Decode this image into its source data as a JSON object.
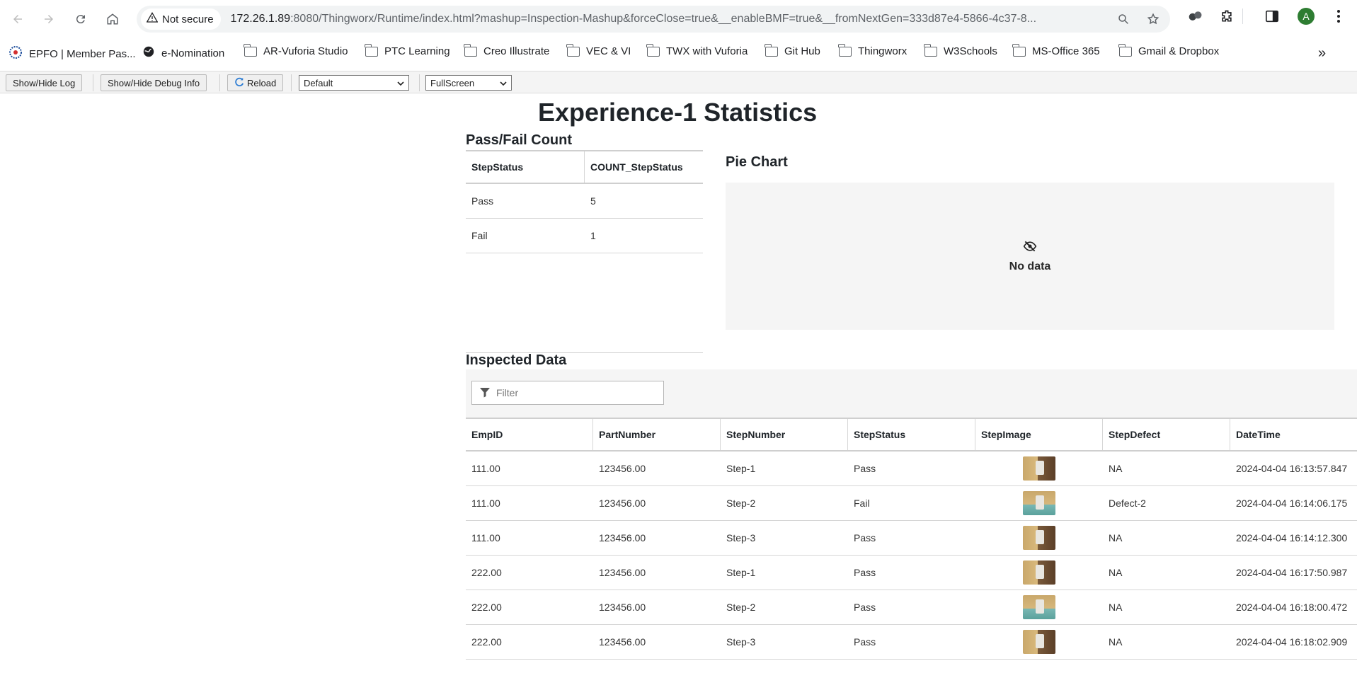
{
  "browser": {
    "security_label": "Not secure",
    "url_host": "172.26.1.89",
    "url_rest": ":8080/Thingworx/Runtime/index.html?mashup=Inspection-Mashup&forceClose=true&__enableBMF=true&__fromNextGen=333d87e4-5866-4c37-8...",
    "avatar_letter": "A"
  },
  "bookmarks": [
    {
      "label": "EPFO | Member Pas...",
      "icon": "epfo-logo-icon"
    },
    {
      "label": "e-Nomination",
      "icon": "globe-icon"
    },
    {
      "label": "AR-Vuforia Studio",
      "icon": "folder-icon"
    },
    {
      "label": "PTC Learning",
      "icon": "folder-icon"
    },
    {
      "label": "Creo Illustrate",
      "icon": "folder-icon"
    },
    {
      "label": "VEC & VI",
      "icon": "folder-icon"
    },
    {
      "label": "TWX with Vuforia",
      "icon": "folder-icon"
    },
    {
      "label": "Git Hub",
      "icon": "folder-icon"
    },
    {
      "label": "Thingworx",
      "icon": "folder-icon"
    },
    {
      "label": "W3Schools",
      "icon": "folder-icon"
    },
    {
      "label": "MS-Office 365",
      "icon": "folder-icon"
    },
    {
      "label": "Gmail & Dropbox",
      "icon": "folder-icon"
    }
  ],
  "toolbar": {
    "log_label": "Show/Hide Log",
    "debug_label": "Show/Hide Debug Info",
    "reload_label": "Reload",
    "theme_select": "Default",
    "view_select": "FullScreen"
  },
  "page": {
    "title": "Experience-1 Statistics",
    "count_title": "Pass/Fail Count",
    "pie_title": "Pie Chart",
    "pie_empty": "No data",
    "inspected_title": "Inspected Data",
    "filter_placeholder": "Filter"
  },
  "count_table": {
    "headers": [
      "StepStatus",
      "COUNT_StepStatus"
    ],
    "rows": [
      [
        "Pass",
        "5"
      ],
      [
        "Fail",
        "1"
      ]
    ]
  },
  "inspected_table": {
    "headers": [
      "EmpID",
      "PartNumber",
      "StepNumber",
      "StepStatus",
      "StepImage",
      "StepDefect",
      "DateTime"
    ],
    "rows": [
      [
        "111.00",
        "123456.00",
        "Step-1",
        "Pass",
        "",
        "NA",
        "2024-04-04 16:13:57.847"
      ],
      [
        "111.00",
        "123456.00",
        "Step-2",
        "Fail",
        "",
        "Defect-2",
        "2024-04-04 16:14:06.175"
      ],
      [
        "111.00",
        "123456.00",
        "Step-3",
        "Pass",
        "",
        "NA",
        "2024-04-04 16:14:12.300"
      ],
      [
        "222.00",
        "123456.00",
        "Step-1",
        "Pass",
        "",
        "NA",
        "2024-04-04 16:17:50.987"
      ],
      [
        "222.00",
        "123456.00",
        "Step-2",
        "Pass",
        "",
        "NA",
        "2024-04-04 16:18:00.472"
      ],
      [
        "222.00",
        "123456.00",
        "Step-3",
        "Pass",
        "",
        "NA",
        "2024-04-04 16:18:02.909"
      ]
    ]
  }
}
